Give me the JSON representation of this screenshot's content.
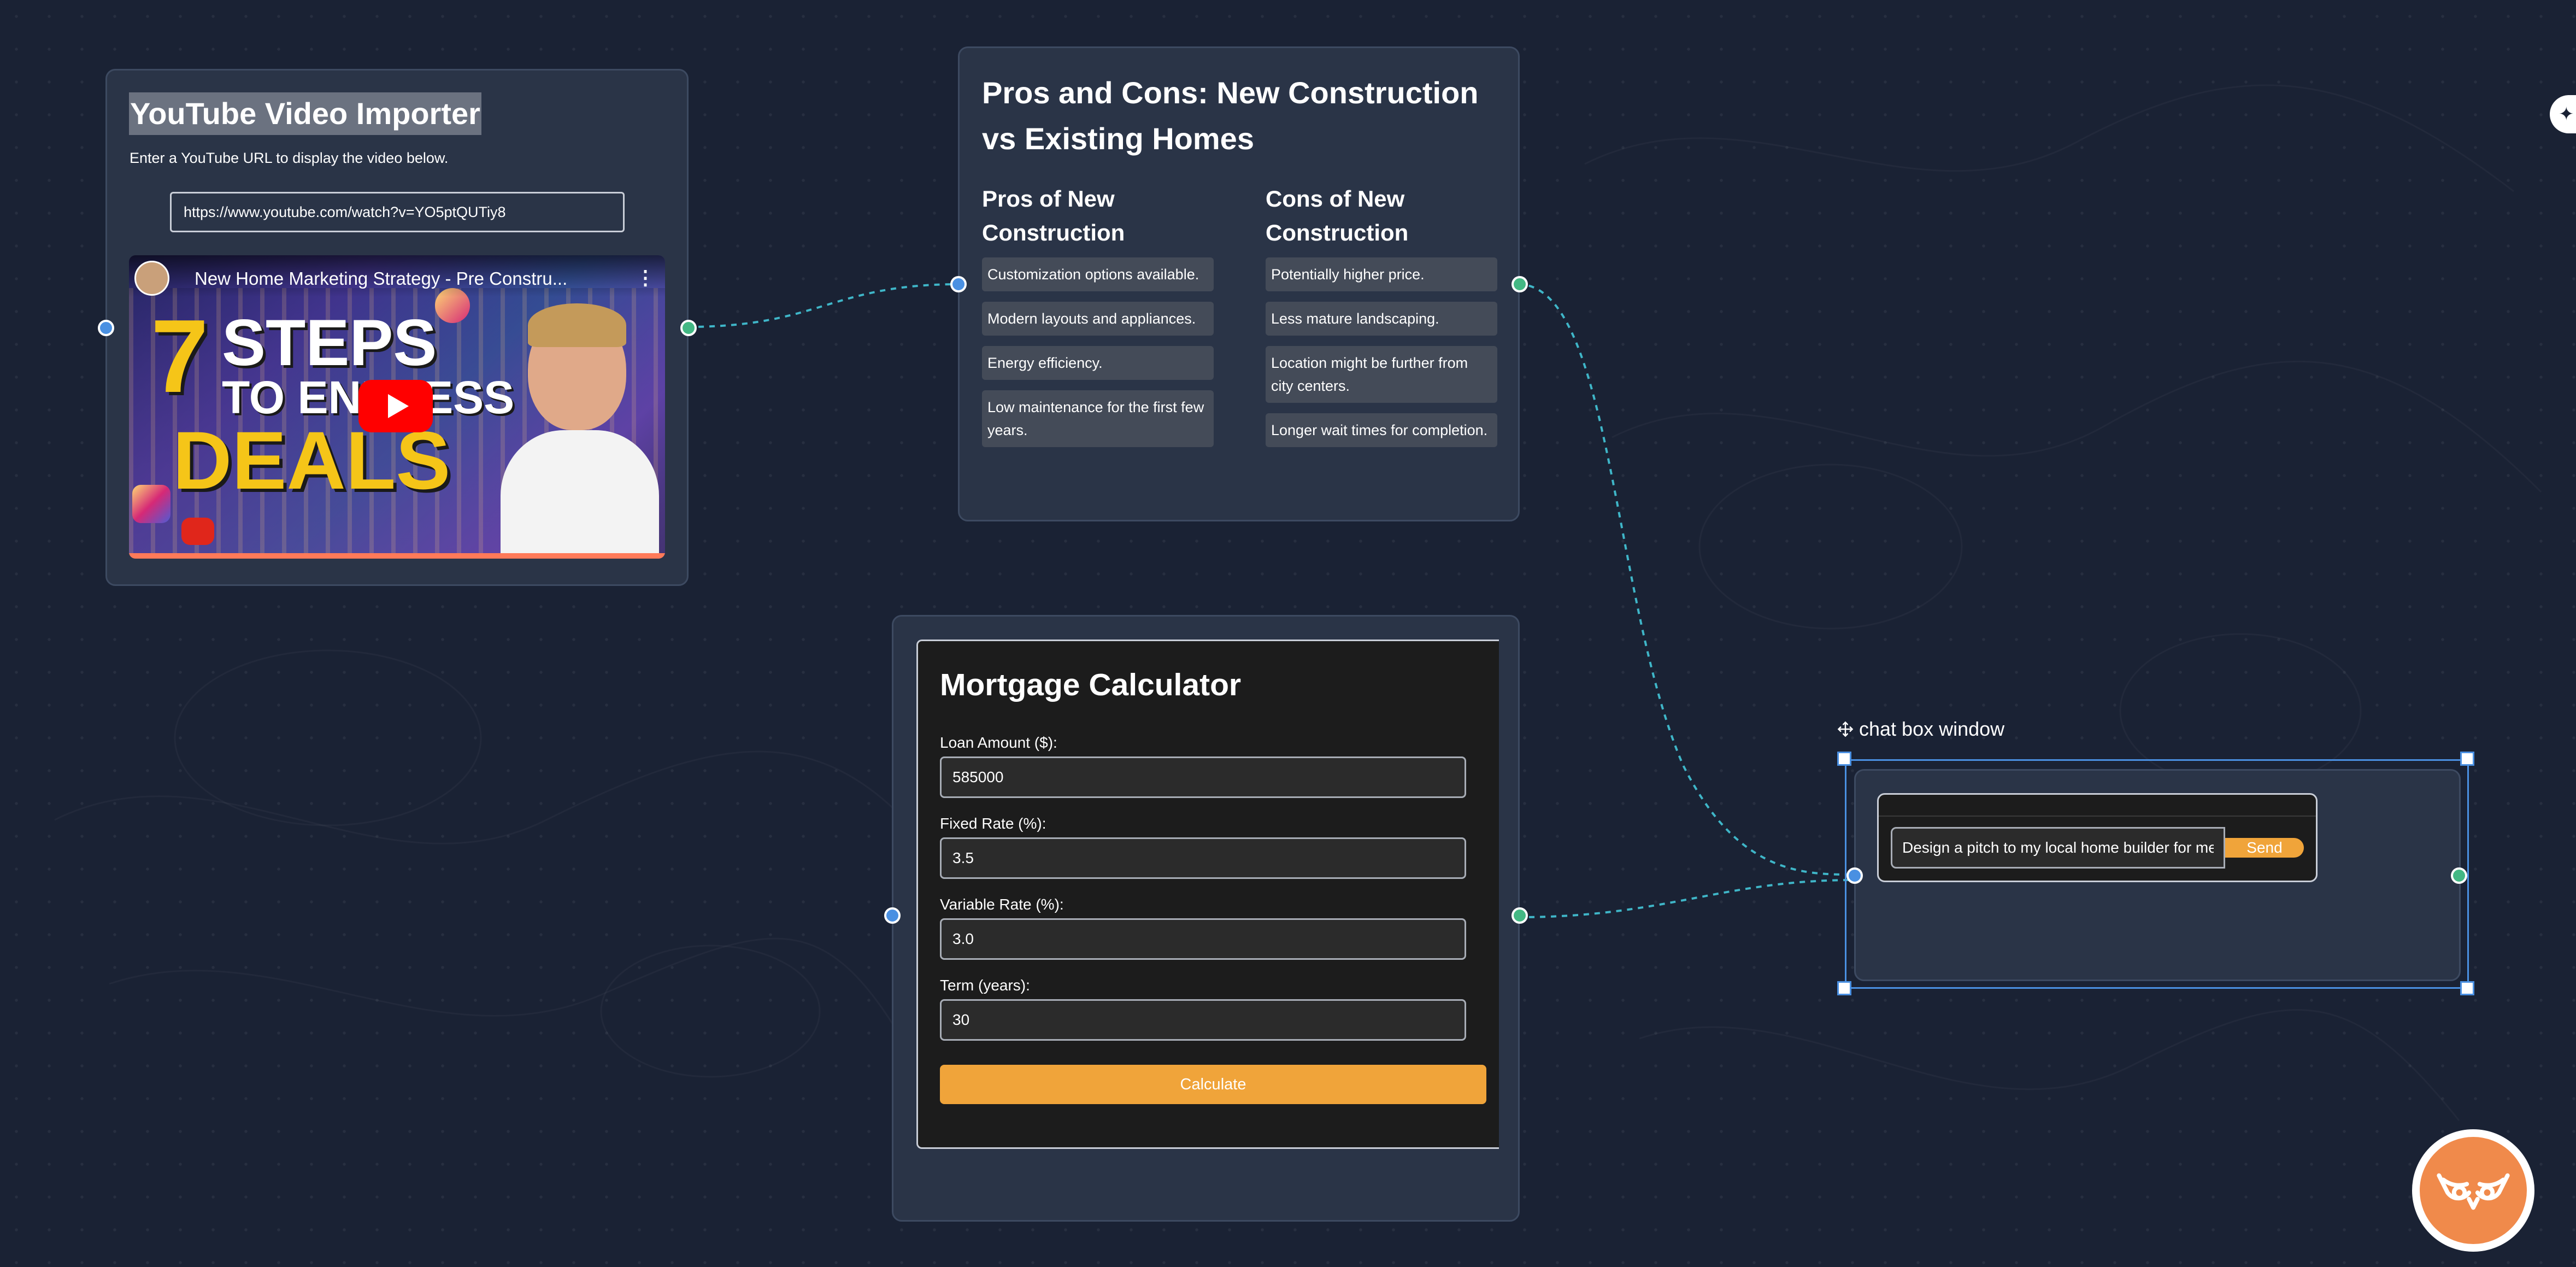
{
  "youtube_node": {
    "title": "YouTube Video Importer",
    "description": "Enter a YouTube URL to display the video below.",
    "url_value": "https://www.youtube.com/watch?v=YO5ptQUTiy8",
    "video": {
      "title": "New Home Marketing Strategy - Pre Constru...",
      "thumbnail_number": "7",
      "thumbnail_line1": "STEPS",
      "thumbnail_line2": "TO ENDLESS",
      "thumbnail_line3": "DEALS"
    }
  },
  "pros_cons_node": {
    "title": "Pros and Cons: New Construction vs Existing Homes",
    "pros_heading": "Pros of New Construction",
    "cons_heading": "Cons of New Construction",
    "pros": [
      "Customization options available.",
      "Modern layouts and appliances.",
      "Energy efficiency.",
      "Low maintenance for the first few years."
    ],
    "cons": [
      "Potentially higher price.",
      "Less mature landscaping.",
      "Location might be further from city centers.",
      "Longer wait times for completion."
    ]
  },
  "mortgage_node": {
    "title": "Mortgage Calculator",
    "fields": [
      {
        "label": "Loan Amount ($):",
        "value": "585000"
      },
      {
        "label": "Fixed Rate (%):",
        "value": "3.5"
      },
      {
        "label": "Variable Rate (%):",
        "value": "3.0"
      },
      {
        "label": "Term (years):",
        "value": "30"
      }
    ],
    "calculate_label": "Calculate"
  },
  "chat_node": {
    "label": "chat box window",
    "input_value": "Design a pitch to my local home builder for me",
    "send_label": "Send"
  },
  "colors": {
    "canvas_bg": "#1a2234",
    "node_bg": "#2a3447",
    "accent_orange": "#f0a43a",
    "handle_blue": "#4a90e2",
    "handle_green": "#43b884",
    "edge_teal": "#3fb6c8",
    "logo_orange": "#f08a4b"
  },
  "icons": {
    "move": "move-icon",
    "play": "play-icon",
    "sparkle": "sparkle-icon",
    "logo": "owl-logo-icon"
  }
}
